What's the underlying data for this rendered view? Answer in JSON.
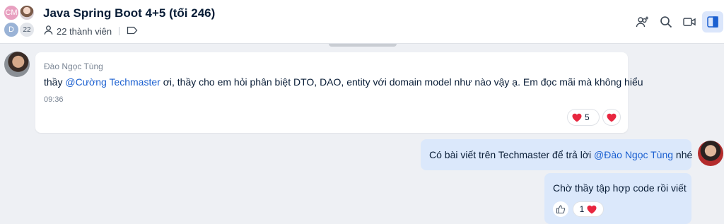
{
  "header": {
    "title": "Java Spring Boot 4+5 (tối 246)",
    "members": "22 thành viên",
    "avatars": {
      "a1": "CM",
      "a2": "D",
      "count": "22"
    },
    "accent": "#dbe6fb"
  },
  "messages": [
    {
      "sender": "Đào Ngọc Tùng",
      "text_pre": "thầy ",
      "mention": "@Cường Techmaster",
      "text_post": "  ơi, thầy cho em hỏi phân biệt DTO, DAO, entity với domain model như nào vậy ạ. Em đọc mãi mà không hiểu",
      "time": "09:36",
      "reaction_count": "5",
      "reaction_icon": "heart-icon"
    },
    {
      "text_pre": "Có bài viết trên Techmaster để trả lời ",
      "mention": "@Đào Ngọc Tùng",
      "text_post": " nhé"
    },
    {
      "text": "Chờ thầy tập hợp code rồi viết",
      "reaction_count": "1",
      "reaction_icon": "heart-icon"
    }
  ],
  "colors": {
    "heart": "#e8263f",
    "mention": "#1a5fd0",
    "outgoing_bubble": "#dbe8fb"
  }
}
